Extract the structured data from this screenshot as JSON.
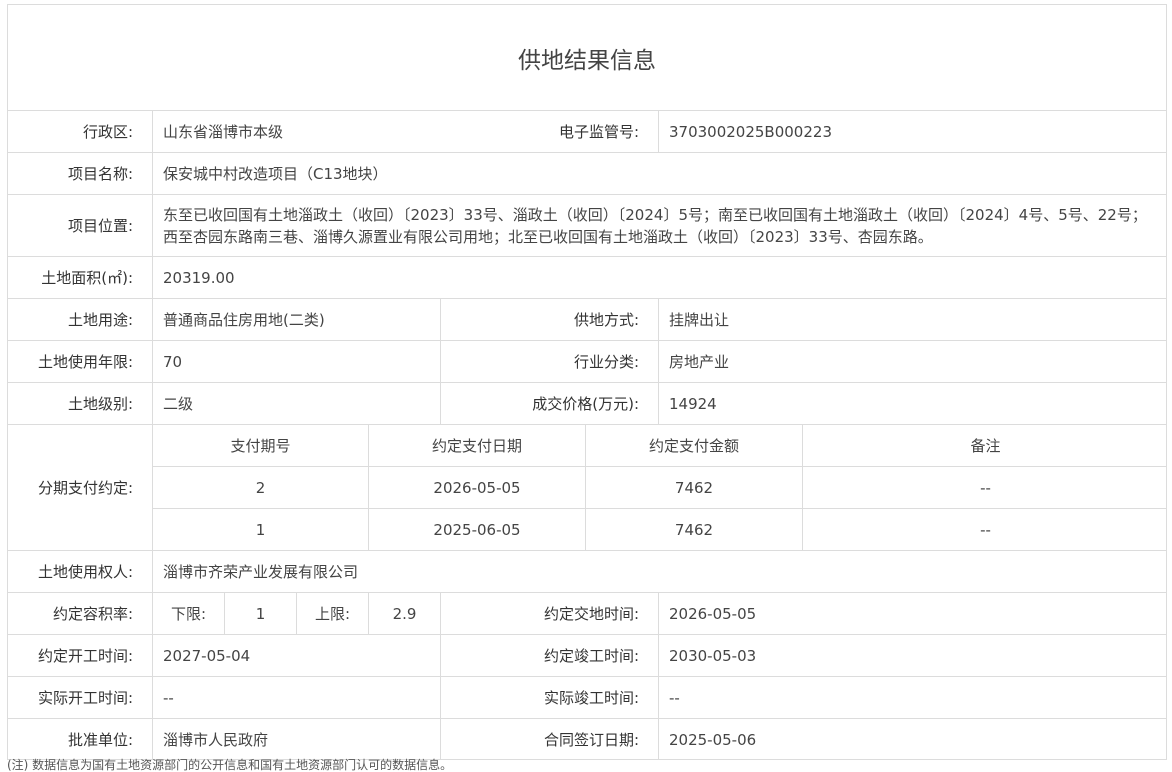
{
  "title": "供地结果信息",
  "labels": {
    "district": "行政区:",
    "supervision_no": "电子监管号:",
    "project_name": "项目名称:",
    "project_location": "项目位置:",
    "land_area": "土地面积(㎡):",
    "land_use": "土地用途:",
    "supply_method": "供地方式:",
    "use_years": "土地使用年限:",
    "industry": "行业分类:",
    "land_grade": "土地级别:",
    "deal_price": "成交价格(万元):",
    "installments": "分期支付约定:",
    "land_user": "土地使用权人:",
    "plot_ratio": "约定容积率:",
    "delivery_time": "约定交地时间:",
    "start_time_agreed": "约定开工时间:",
    "finish_time_agreed": "约定竣工时间:",
    "start_time_actual": "实际开工时间:",
    "finish_time_actual": "实际竣工时间:",
    "approval_unit": "批准单位:",
    "contract_date": "合同签订日期:"
  },
  "values": {
    "district": "山东省淄博市本级",
    "supervision_no": "3703002025B000223",
    "project_name": "保安城中村改造项目（C13地块）",
    "project_location": "东至已收回国有土地淄政土（收回）〔2023〕33号、淄政土（收回）〔2024〕5号；南至已收回国有土地淄政土（收回）〔2024〕4号、5号、22号；西至杏园东路南三巷、淄博久源置业有限公司用地；北至已收回国有土地淄政土（收回）〔2023〕33号、杏园东路。",
    "land_area": "20319.00",
    "land_use": "普通商品住房用地(二类)",
    "supply_method": "挂牌出让",
    "use_years": "70",
    "industry": "房地产业",
    "land_grade": "二级",
    "deal_price": "14924",
    "land_user": "淄博市齐荣产业发展有限公司",
    "plot_ratio_lower_label": "下限:",
    "plot_ratio_lower": "1",
    "plot_ratio_upper_label": "上限:",
    "plot_ratio_upper": "2.9",
    "delivery_time": "2026-05-05",
    "start_time_agreed": "2027-05-04",
    "finish_time_agreed": "2030-05-03",
    "start_time_actual": "--",
    "finish_time_actual": "--",
    "approval_unit": "淄博市人民政府",
    "contract_date": "2025-05-06"
  },
  "installments": {
    "headers": [
      "支付期号",
      "约定支付日期",
      "约定支付金额",
      "备注"
    ],
    "rows": [
      {
        "period": "2",
        "date": "2026-05-05",
        "amount": "7462",
        "note": "--"
      },
      {
        "period": "1",
        "date": "2025-06-05",
        "amount": "7462",
        "note": "--"
      }
    ]
  },
  "footnote": "(注) 数据信息为国有土地资源部门的公开信息和国有土地资源部门认可的数据信息。"
}
